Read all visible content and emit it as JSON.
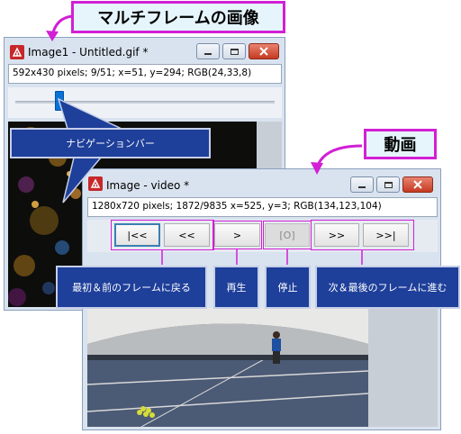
{
  "callouts": {
    "multiframe": "マルチフレームの画像",
    "navbar": "ナビゲーションバー",
    "video": "動画",
    "first_prev": "最初＆前のフレームに戻る",
    "play": "再生",
    "stop": "停止",
    "next_last": "次＆最後のフレームに進む"
  },
  "window1": {
    "title": "Image1 - Untitled.gif *",
    "status": "592x430 pixels; 9/51; x=51, y=294; RGB(24,33,8)",
    "slider": {
      "frame": 9,
      "total": 51
    }
  },
  "window2": {
    "title": "Image - video *",
    "status": "1280x720 pixels; 1872/9835 x=525, y=3; RGB(134,123,104)",
    "buttons": {
      "first": "|<<",
      "prev": "<<",
      "play": ">",
      "stop": "[O]",
      "next": ">>",
      "last": ">>|"
    }
  },
  "colors": {
    "callout_border": "#d21fd5",
    "callout_fill": "#1e3f9a",
    "window_chrome": "#d9e3ef",
    "close_button": "#c53a22",
    "slider_thumb": "#0a72d6"
  }
}
